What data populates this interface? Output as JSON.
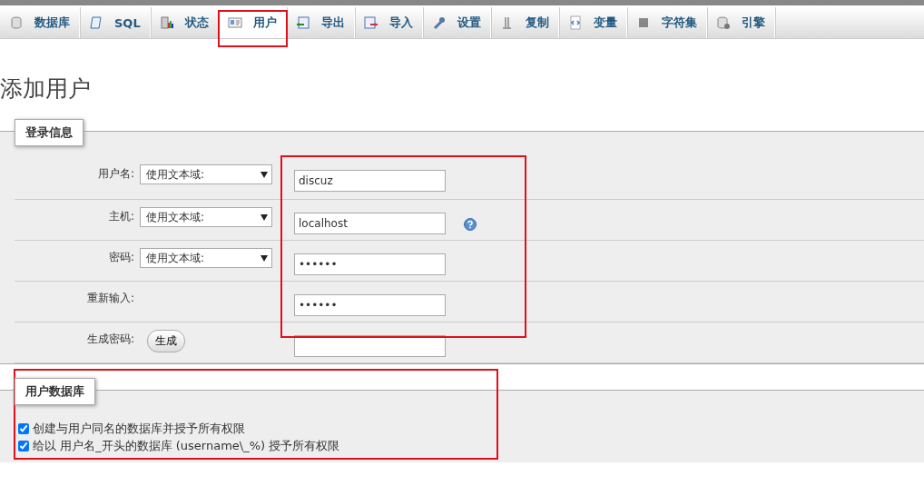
{
  "tabs": [
    {
      "label": "数据库",
      "selected": false,
      "highlighted": false
    },
    {
      "label": "SQL",
      "selected": false,
      "highlighted": false
    },
    {
      "label": "状态",
      "selected": false,
      "highlighted": false
    },
    {
      "label": "用户",
      "selected": true,
      "highlighted": true
    },
    {
      "label": "导出",
      "selected": false,
      "highlighted": false
    },
    {
      "label": "导入",
      "selected": false,
      "highlighted": false
    },
    {
      "label": "设置",
      "selected": false,
      "highlighted": false
    },
    {
      "label": "复制",
      "selected": false,
      "highlighted": false
    },
    {
      "label": "变量",
      "selected": false,
      "highlighted": false
    },
    {
      "label": "字符集",
      "selected": false,
      "highlighted": false
    },
    {
      "label": "引擎",
      "selected": false,
      "highlighted": false
    }
  ],
  "page_title": "添加用户",
  "login_info": {
    "legend": "登录信息",
    "fields_highlighted": true,
    "rows": [
      {
        "label": "用户名:",
        "kind": "select-input",
        "select": "使用文本域:",
        "value": "discuz",
        "help": false
      },
      {
        "label": "主机:",
        "kind": "select-input",
        "select": "使用文本域:",
        "value": "localhost",
        "help": true
      },
      {
        "label": "密码:",
        "kind": "select-password",
        "select": "使用文本域:",
        "value": "••••••",
        "help": false
      },
      {
        "label": "重新输入:",
        "kind": "password",
        "value": "••••••",
        "help": false
      },
      {
        "label": "生成密码:",
        "kind": "generate",
        "button": "生成",
        "help": false
      }
    ]
  },
  "user_database": {
    "legend": "用户数据库",
    "highlighted": true,
    "options": [
      {
        "label": "创建与用户同名的数据库并授予所有权限",
        "checked": true
      },
      {
        "label": "给以 用户名_开头的数据库 (username\\_%) 授予所有权限",
        "checked": true
      }
    ]
  }
}
